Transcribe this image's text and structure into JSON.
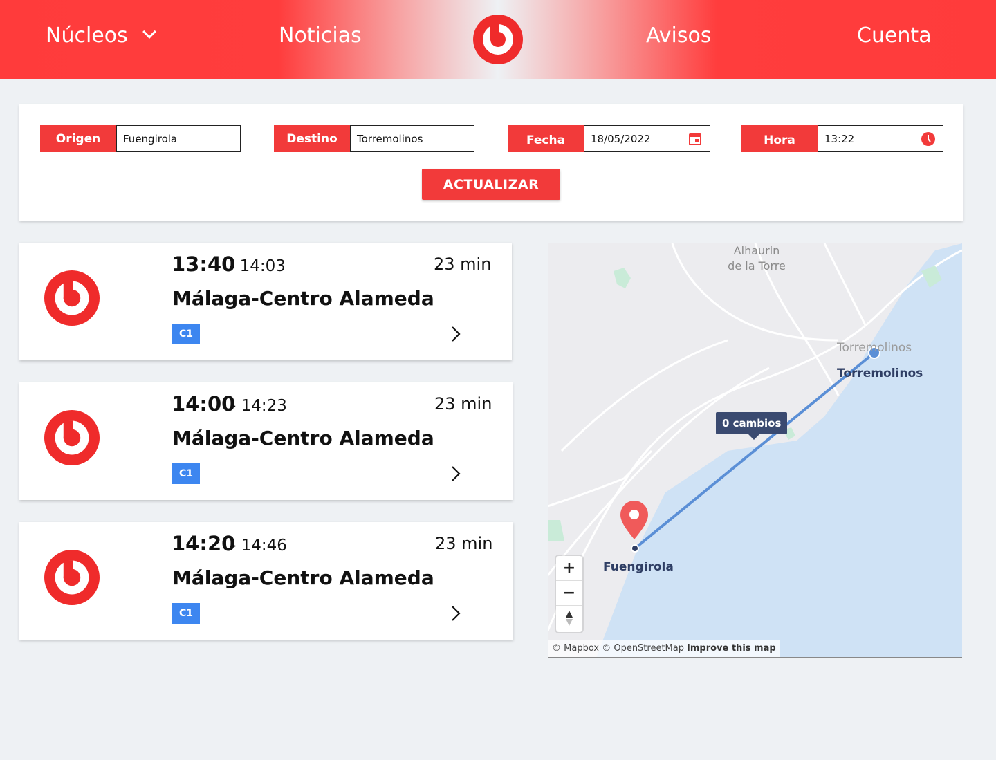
{
  "nav": {
    "nucleos": "Núcleos",
    "noticias": "Noticias",
    "avisos": "Avisos",
    "cuenta": "Cuenta"
  },
  "brand": {
    "accent": "#f23a3a",
    "line_color": "#3d86f0"
  },
  "search": {
    "origen_label": "Origen",
    "origen_value": "Fuengirola",
    "destino_label": "Destino",
    "destino_value": "Torremolinos",
    "fecha_label": "Fecha",
    "fecha_value": "18/05/2022",
    "hora_label": "Hora",
    "hora_value": "13:22",
    "update_label": "ACTUALIZAR",
    "calendar_icon": "calendar-icon",
    "clock_icon": "clock-icon"
  },
  "results": [
    {
      "departure": "13:40",
      "arrival": "- 14:03",
      "duration": "23 min",
      "destination": "Málaga-Centro Alameda",
      "line": "C1"
    },
    {
      "departure": "14:00",
      "arrival": "- 14:23",
      "duration": "23 min",
      "destination": "Málaga-Centro Alameda",
      "line": "C1"
    },
    {
      "departure": "14:20",
      "arrival": "- 14:46",
      "duration": "23 min",
      "destination": "Málaga-Centro Alameda",
      "line": "C1"
    }
  ],
  "map": {
    "place_alhaurin": "Alhaurín\nde la Torre",
    "place_alhaurin_1": "Alhaurin",
    "place_alhaurin_2": "de la Torre",
    "place_torremolinos_gray": "Torremolinos",
    "station_torremolinos": "Torremolinos",
    "station_fuengirola": "Fuengirola",
    "changes_badge": "0 cambios",
    "zoom_in": "+",
    "zoom_out": "−",
    "compass": "compass-icon",
    "attribution": "© Mapbox © OpenStreetMap",
    "improve": "Improve this map"
  }
}
